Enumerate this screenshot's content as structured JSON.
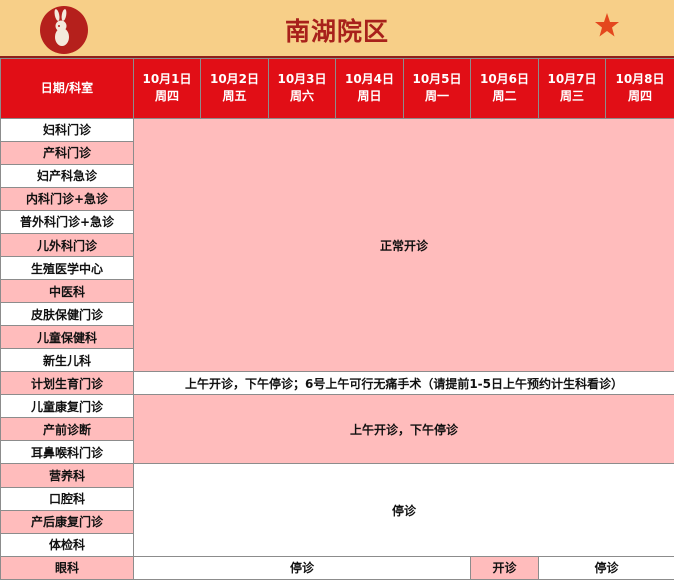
{
  "header": {
    "title": "南湖院区",
    "logo_icon": "rabbit-on-red-circle-icon",
    "star_icon": "star-icon"
  },
  "colors": {
    "header_bg": "#f7cf88",
    "title": "#a8211b",
    "column_header_bg": "#e10e16",
    "pink_cell": "#ffbcbc"
  },
  "table": {
    "corner_label": "日期/科室",
    "days": [
      {
        "date": "10月1日",
        "weekday": "周四"
      },
      {
        "date": "10月2日",
        "weekday": "周五"
      },
      {
        "date": "10月3日",
        "weekday": "周六"
      },
      {
        "date": "10月4日",
        "weekday": "周日"
      },
      {
        "date": "10月5日",
        "weekday": "周一"
      },
      {
        "date": "10月6日",
        "weekday": "周二"
      },
      {
        "date": "10月7日",
        "weekday": "周三"
      },
      {
        "date": "10月8日",
        "weekday": "周四"
      }
    ],
    "departments": [
      "妇科门诊",
      "产科门诊",
      "妇产科急诊",
      "内科门诊+急诊",
      "普外科门诊+急诊",
      "儿外科门诊",
      "生殖医学中心",
      "中医科",
      "皮肤保健门诊",
      "儿童保健科",
      "新生儿科",
      "计划生育门诊",
      "儿童康复门诊",
      "产前诊断",
      "耳鼻喉科门诊",
      "营养科",
      "口腔科",
      "产后康复门诊",
      "体检科",
      "眼科"
    ],
    "blocks": {
      "normal": "正常开诊",
      "family_planning": "上午开诊，下午停诊；6号上午可行无痛手术（请提前1-5日上午预约计生科看诊）",
      "morning_only": "上午开诊，下午停诊",
      "closed": "停诊"
    },
    "eye_row": {
      "oct1_5": "停诊",
      "oct6": "开诊",
      "oct7_8": "停诊"
    }
  }
}
